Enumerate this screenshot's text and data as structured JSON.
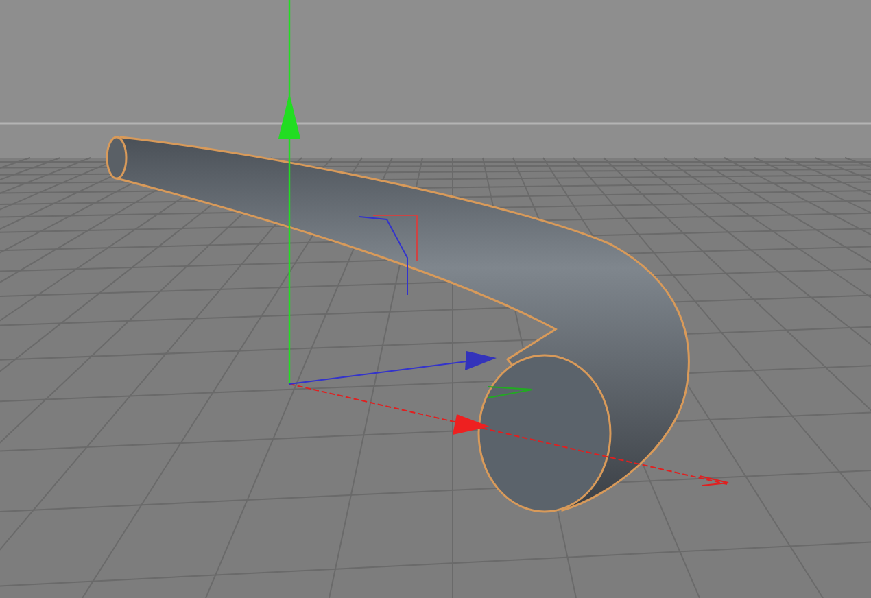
{
  "viewport": {
    "grid": {
      "visible": true
    },
    "object": {
      "selected": true
    },
    "axes": {
      "visible": true
    }
  }
}
